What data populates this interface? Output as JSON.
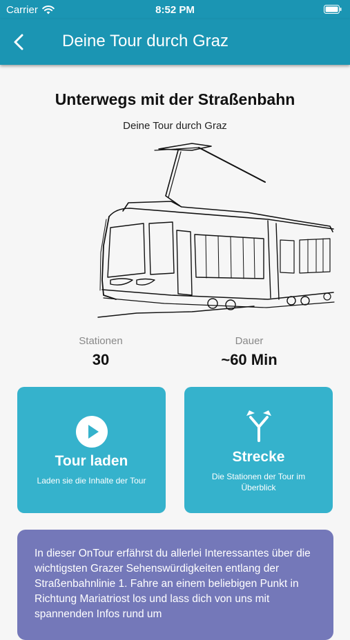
{
  "status_bar": {
    "carrier": "Carrier",
    "time": "8:52 PM"
  },
  "nav": {
    "title": "Deine Tour durch Graz",
    "back_icon": "chevron-left-icon"
  },
  "hero": {
    "title": "Unterwegs mit der Straßenbahn",
    "subtitle": "Deine Tour durch Graz",
    "illustration": "tram-illustration"
  },
  "stats": [
    {
      "label": "Stationen",
      "value": "30"
    },
    {
      "label": "Dauer",
      "value": "~60 Min"
    }
  ],
  "cards": [
    {
      "title": "Tour laden",
      "subtitle": "Laden sie die Inhalte der Tour",
      "icon": "play-circle-icon"
    },
    {
      "title": "Strecke",
      "subtitle": "Die Stationen der Tour im Überblick",
      "icon": "route-split-icon"
    }
  ],
  "info": {
    "text": "In dieser OnTour erfährst du allerlei Interessantes über die wichtigsten Grazer Sehenswürdigkeiten entlang der Straßenbahnlinie 1. Fahre an einem beliebigen Punkt in Richtung Mariatriost los und lass dich von uns mit spannenden Infos rund um"
  },
  "colors": {
    "primary": "#1b95b3",
    "card": "#35b2cc",
    "info_box": "#7478b9",
    "background": "#f6f6f6"
  }
}
